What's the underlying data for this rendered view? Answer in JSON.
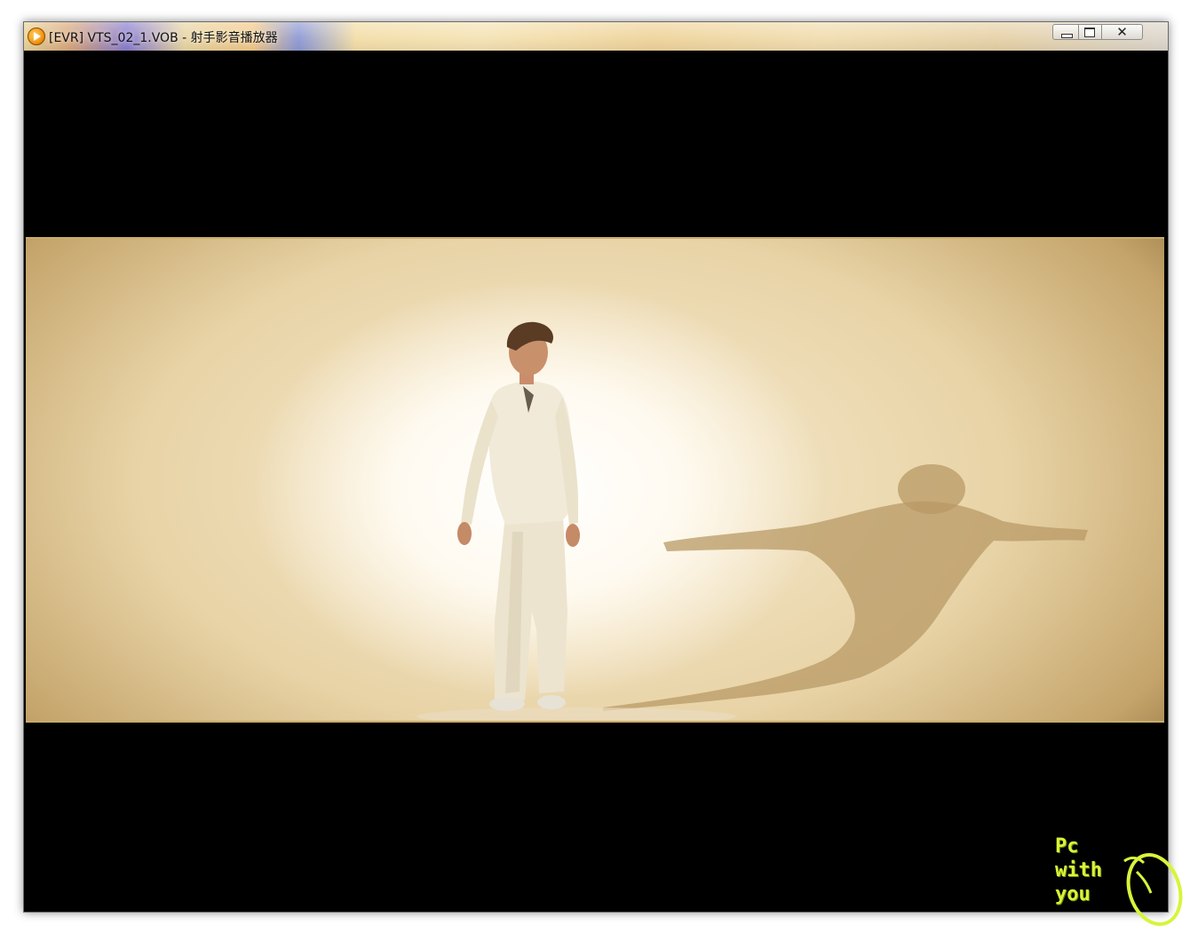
{
  "window": {
    "title": "[EVR] VTS_02_1.VOB - 射手影音播放器",
    "app_icon": "play-circle-icon",
    "controls": {
      "minimize_icon": "minimize-icon",
      "maximize_icon": "maximize-icon",
      "close_icon": "close-icon",
      "close_glyph": "✕"
    }
  },
  "video": {
    "scene": "man in white clothes standing in front of a wall with winged shadow"
  },
  "watermark": {
    "lines": [
      "Pc",
      "with",
      "you"
    ],
    "icon": "mouse-icon",
    "color": "#d8f43a"
  }
}
